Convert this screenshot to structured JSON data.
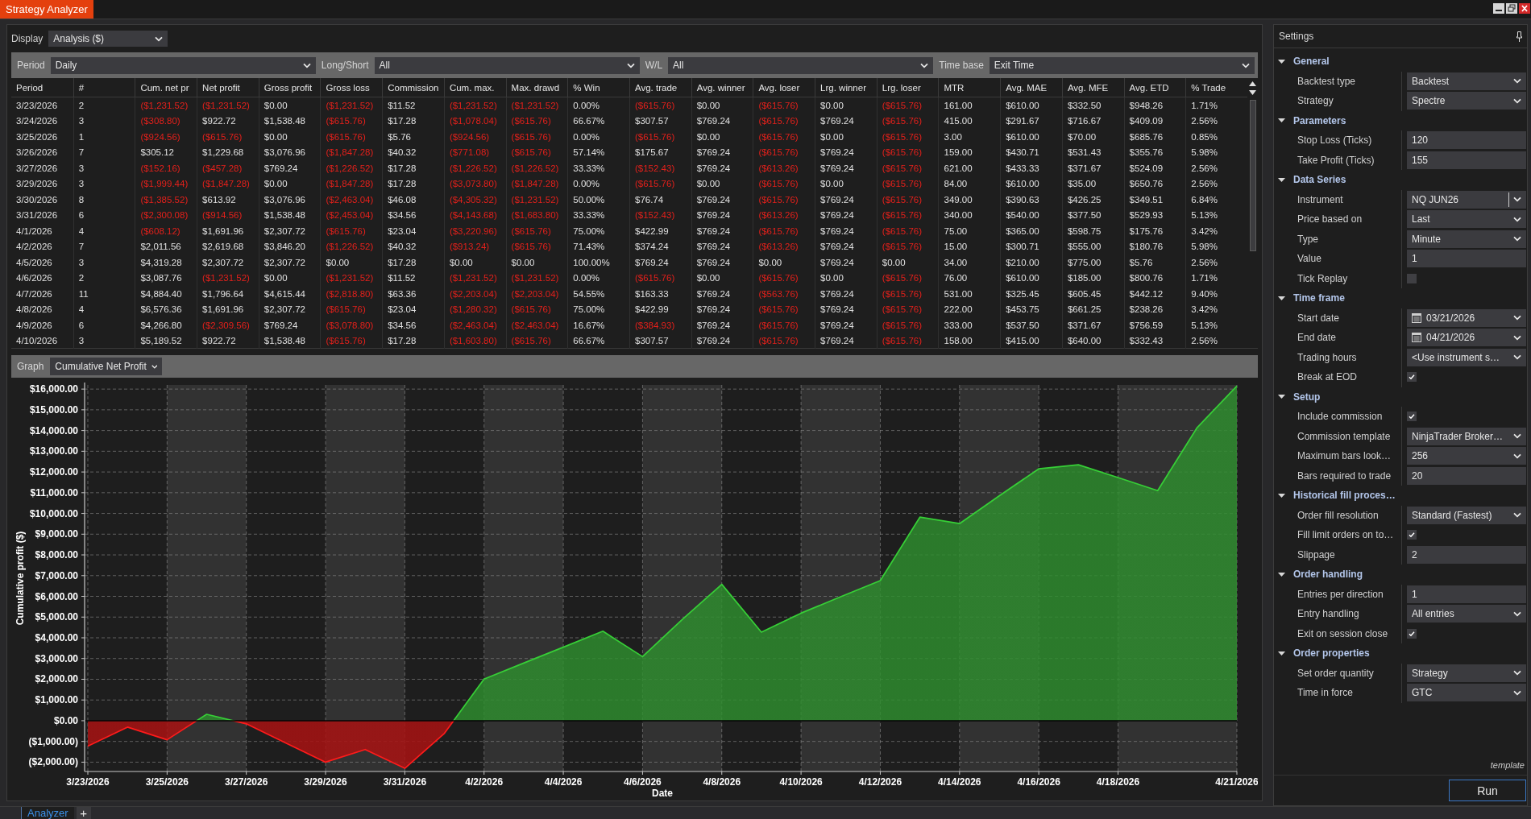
{
  "window": {
    "title": "Strategy Analyzer"
  },
  "display": {
    "label": "Display",
    "value": "Analysis ($)"
  },
  "filters": [
    {
      "label": "Period",
      "value": "Daily"
    },
    {
      "label": "Long/Short",
      "value": "All"
    },
    {
      "label": "W/L",
      "value": "All"
    },
    {
      "label": "Time base",
      "value": "Exit Time"
    }
  ],
  "table": {
    "columns": [
      "Period",
      "#",
      "Cum. net pr",
      "Net profit",
      "Gross profit",
      "Gross loss",
      "Commission",
      "Cum. max.",
      "Max. drawd",
      "% Win",
      "Avg. trade",
      "Avg. winner",
      "Avg. loser",
      "Lrg. winner",
      "Lrg. loser",
      "MTR",
      "Avg. MAE",
      "Avg. MFE",
      "Avg. ETD",
      "% Trade"
    ],
    "rows": [
      {
        "cells": [
          {
            "text": "3/23/2026",
            "negative": false
          },
          {
            "text": "2",
            "negative": false
          },
          {
            "text": "($1,231.52)",
            "negative": true
          },
          {
            "text": "($1,231.52)",
            "negative": true
          },
          {
            "text": "$0.00",
            "negative": false
          },
          {
            "text": "($1,231.52)",
            "negative": true
          },
          {
            "text": "$11.52",
            "negative": false
          },
          {
            "text": "($1,231.52)",
            "negative": true
          },
          {
            "text": "($1,231.52)",
            "negative": true
          },
          {
            "text": "0.00%",
            "negative": false
          },
          {
            "text": "($615.76)",
            "negative": true
          },
          {
            "text": "$0.00",
            "negative": false
          },
          {
            "text": "($615.76)",
            "negative": true
          },
          {
            "text": "$0.00",
            "negative": false
          },
          {
            "text": "($615.76)",
            "negative": true
          },
          {
            "text": "161.00",
            "negative": false
          },
          {
            "text": "$610.00",
            "negative": false
          },
          {
            "text": "$332.50",
            "negative": false
          },
          {
            "text": "$948.26",
            "negative": false
          },
          {
            "text": "1.71%",
            "negative": false
          }
        ]
      },
      {
        "cells": [
          {
            "text": "3/24/2026",
            "negative": false
          },
          {
            "text": "3",
            "negative": false
          },
          {
            "text": "($308.80)",
            "negative": true
          },
          {
            "text": "$922.72",
            "negative": false
          },
          {
            "text": "$1,538.48",
            "negative": false
          },
          {
            "text": "($615.76)",
            "negative": true
          },
          {
            "text": "$17.28",
            "negative": false
          },
          {
            "text": "($1,078.04)",
            "negative": true
          },
          {
            "text": "($615.76)",
            "negative": true
          },
          {
            "text": "66.67%",
            "negative": false
          },
          {
            "text": "$307.57",
            "negative": false
          },
          {
            "text": "$769.24",
            "negative": false
          },
          {
            "text": "($615.76)",
            "negative": true
          },
          {
            "text": "$769.24",
            "negative": false
          },
          {
            "text": "($615.76)",
            "negative": true
          },
          {
            "text": "415.00",
            "negative": false
          },
          {
            "text": "$291.67",
            "negative": false
          },
          {
            "text": "$716.67",
            "negative": false
          },
          {
            "text": "$409.09",
            "negative": false
          },
          {
            "text": "2.56%",
            "negative": false
          }
        ]
      },
      {
        "cells": [
          {
            "text": "3/25/2026",
            "negative": false
          },
          {
            "text": "1",
            "negative": false
          },
          {
            "text": "($924.56)",
            "negative": true
          },
          {
            "text": "($615.76)",
            "negative": true
          },
          {
            "text": "$0.00",
            "negative": false
          },
          {
            "text": "($615.76)",
            "negative": true
          },
          {
            "text": "$5.76",
            "negative": false
          },
          {
            "text": "($924.56)",
            "negative": true
          },
          {
            "text": "($615.76)",
            "negative": true
          },
          {
            "text": "0.00%",
            "negative": false
          },
          {
            "text": "($615.76)",
            "negative": true
          },
          {
            "text": "$0.00",
            "negative": false
          },
          {
            "text": "($615.76)",
            "negative": true
          },
          {
            "text": "$0.00",
            "negative": false
          },
          {
            "text": "($615.76)",
            "negative": true
          },
          {
            "text": "3.00",
            "negative": false
          },
          {
            "text": "$610.00",
            "negative": false
          },
          {
            "text": "$70.00",
            "negative": false
          },
          {
            "text": "$685.76",
            "negative": false
          },
          {
            "text": "0.85%",
            "negative": false
          }
        ]
      },
      {
        "cells": [
          {
            "text": "3/26/2026",
            "negative": false
          },
          {
            "text": "7",
            "negative": false
          },
          {
            "text": "$305.12",
            "negative": false
          },
          {
            "text": "$1,229.68",
            "negative": false
          },
          {
            "text": "$3,076.96",
            "negative": false
          },
          {
            "text": "($1,847.28)",
            "negative": true
          },
          {
            "text": "$40.32",
            "negative": false
          },
          {
            "text": "($771.08)",
            "negative": true
          },
          {
            "text": "($615.76)",
            "negative": true
          },
          {
            "text": "57.14%",
            "negative": false
          },
          {
            "text": "$175.67",
            "negative": false
          },
          {
            "text": "$769.24",
            "negative": false
          },
          {
            "text": "($615.76)",
            "negative": true
          },
          {
            "text": "$769.24",
            "negative": false
          },
          {
            "text": "($615.76)",
            "negative": true
          },
          {
            "text": "159.00",
            "negative": false
          },
          {
            "text": "$430.71",
            "negative": false
          },
          {
            "text": "$531.43",
            "negative": false
          },
          {
            "text": "$355.76",
            "negative": false
          },
          {
            "text": "5.98%",
            "negative": false
          }
        ]
      },
      {
        "cells": [
          {
            "text": "3/27/2026",
            "negative": false
          },
          {
            "text": "3",
            "negative": false
          },
          {
            "text": "($152.16)",
            "negative": true
          },
          {
            "text": "($457.28)",
            "negative": true
          },
          {
            "text": "$769.24",
            "negative": false
          },
          {
            "text": "($1,226.52)",
            "negative": true
          },
          {
            "text": "$17.28",
            "negative": false
          },
          {
            "text": "($1,226.52)",
            "negative": true
          },
          {
            "text": "($1,226.52)",
            "negative": true
          },
          {
            "text": "33.33%",
            "negative": false
          },
          {
            "text": "($152.43)",
            "negative": true
          },
          {
            "text": "$769.24",
            "negative": false
          },
          {
            "text": "($613.26)",
            "negative": true
          },
          {
            "text": "$769.24",
            "negative": false
          },
          {
            "text": "($615.76)",
            "negative": true
          },
          {
            "text": "621.00",
            "negative": false
          },
          {
            "text": "$433.33",
            "negative": false
          },
          {
            "text": "$371.67",
            "negative": false
          },
          {
            "text": "$524.09",
            "negative": false
          },
          {
            "text": "2.56%",
            "negative": false
          }
        ]
      },
      {
        "cells": [
          {
            "text": "3/29/2026",
            "negative": false
          },
          {
            "text": "3",
            "negative": false
          },
          {
            "text": "($1,999.44)",
            "negative": true
          },
          {
            "text": "($1,847.28)",
            "negative": true
          },
          {
            "text": "$0.00",
            "negative": false
          },
          {
            "text": "($1,847.28)",
            "negative": true
          },
          {
            "text": "$17.28",
            "negative": false
          },
          {
            "text": "($3,073.80)",
            "negative": true
          },
          {
            "text": "($1,847.28)",
            "negative": true
          },
          {
            "text": "0.00%",
            "negative": false
          },
          {
            "text": "($615.76)",
            "negative": true
          },
          {
            "text": "$0.00",
            "negative": false
          },
          {
            "text": "($615.76)",
            "negative": true
          },
          {
            "text": "$0.00",
            "negative": false
          },
          {
            "text": "($615.76)",
            "negative": true
          },
          {
            "text": "84.00",
            "negative": false
          },
          {
            "text": "$610.00",
            "negative": false
          },
          {
            "text": "$35.00",
            "negative": false
          },
          {
            "text": "$650.76",
            "negative": false
          },
          {
            "text": "2.56%",
            "negative": false
          }
        ]
      },
      {
        "cells": [
          {
            "text": "3/30/2026",
            "negative": false
          },
          {
            "text": "8",
            "negative": false
          },
          {
            "text": "($1,385.52)",
            "negative": true
          },
          {
            "text": "$613.92",
            "negative": false
          },
          {
            "text": "$3,076.96",
            "negative": false
          },
          {
            "text": "($2,463.04)",
            "negative": true
          },
          {
            "text": "$46.08",
            "negative": false
          },
          {
            "text": "($4,305.32)",
            "negative": true
          },
          {
            "text": "($1,231.52)",
            "negative": true
          },
          {
            "text": "50.00%",
            "negative": false
          },
          {
            "text": "$76.74",
            "negative": false
          },
          {
            "text": "$769.24",
            "negative": false
          },
          {
            "text": "($615.76)",
            "negative": true
          },
          {
            "text": "$769.24",
            "negative": false
          },
          {
            "text": "($615.76)",
            "negative": true
          },
          {
            "text": "349.00",
            "negative": false
          },
          {
            "text": "$390.63",
            "negative": false
          },
          {
            "text": "$426.25",
            "negative": false
          },
          {
            "text": "$349.51",
            "negative": false
          },
          {
            "text": "6.84%",
            "negative": false
          }
        ]
      },
      {
        "cells": [
          {
            "text": "3/31/2026",
            "negative": false
          },
          {
            "text": "6",
            "negative": false
          },
          {
            "text": "($2,300.08)",
            "negative": true
          },
          {
            "text": "($914.56)",
            "negative": true
          },
          {
            "text": "$1,538.48",
            "negative": false
          },
          {
            "text": "($2,453.04)",
            "negative": true
          },
          {
            "text": "$34.56",
            "negative": false
          },
          {
            "text": "($4,143.68)",
            "negative": true
          },
          {
            "text": "($1,683.80)",
            "negative": true
          },
          {
            "text": "33.33%",
            "negative": false
          },
          {
            "text": "($152.43)",
            "negative": true
          },
          {
            "text": "$769.24",
            "negative": false
          },
          {
            "text": "($613.26)",
            "negative": true
          },
          {
            "text": "$769.24",
            "negative": false
          },
          {
            "text": "($615.76)",
            "negative": true
          },
          {
            "text": "340.00",
            "negative": false
          },
          {
            "text": "$540.00",
            "negative": false
          },
          {
            "text": "$377.50",
            "negative": false
          },
          {
            "text": "$529.93",
            "negative": false
          },
          {
            "text": "5.13%",
            "negative": false
          }
        ]
      },
      {
        "cells": [
          {
            "text": "4/1/2026",
            "negative": false
          },
          {
            "text": "4",
            "negative": false
          },
          {
            "text": "($608.12)",
            "negative": true
          },
          {
            "text": "$1,691.96",
            "negative": false
          },
          {
            "text": "$2,307.72",
            "negative": false
          },
          {
            "text": "($615.76)",
            "negative": true
          },
          {
            "text": "$23.04",
            "negative": false
          },
          {
            "text": "($3,220.96)",
            "negative": true
          },
          {
            "text": "($615.76)",
            "negative": true
          },
          {
            "text": "75.00%",
            "negative": false
          },
          {
            "text": "$422.99",
            "negative": false
          },
          {
            "text": "$769.24",
            "negative": false
          },
          {
            "text": "($615.76)",
            "negative": true
          },
          {
            "text": "$769.24",
            "negative": false
          },
          {
            "text": "($615.76)",
            "negative": true
          },
          {
            "text": "75.00",
            "negative": false
          },
          {
            "text": "$365.00",
            "negative": false
          },
          {
            "text": "$598.75",
            "negative": false
          },
          {
            "text": "$175.76",
            "negative": false
          },
          {
            "text": "3.42%",
            "negative": false
          }
        ]
      },
      {
        "cells": [
          {
            "text": "4/2/2026",
            "negative": false
          },
          {
            "text": "7",
            "negative": false
          },
          {
            "text": "$2,011.56",
            "negative": false
          },
          {
            "text": "$2,619.68",
            "negative": false
          },
          {
            "text": "$3,846.20",
            "negative": false
          },
          {
            "text": "($1,226.52)",
            "negative": true
          },
          {
            "text": "$40.32",
            "negative": false
          },
          {
            "text": "($913.24)",
            "negative": true
          },
          {
            "text": "($615.76)",
            "negative": true
          },
          {
            "text": "71.43%",
            "negative": false
          },
          {
            "text": "$374.24",
            "negative": false
          },
          {
            "text": "$769.24",
            "negative": false
          },
          {
            "text": "($613.26)",
            "negative": true
          },
          {
            "text": "$769.24",
            "negative": false
          },
          {
            "text": "($615.76)",
            "negative": true
          },
          {
            "text": "15.00",
            "negative": false
          },
          {
            "text": "$300.71",
            "negative": false
          },
          {
            "text": "$555.00",
            "negative": false
          },
          {
            "text": "$180.76",
            "negative": false
          },
          {
            "text": "5.98%",
            "negative": false
          }
        ]
      },
      {
        "cells": [
          {
            "text": "4/5/2026",
            "negative": false
          },
          {
            "text": "3",
            "negative": false
          },
          {
            "text": "$4,319.28",
            "negative": false
          },
          {
            "text": "$2,307.72",
            "negative": false
          },
          {
            "text": "$2,307.72",
            "negative": false
          },
          {
            "text": "$0.00",
            "negative": false
          },
          {
            "text": "$17.28",
            "negative": false
          },
          {
            "text": "$0.00",
            "negative": false
          },
          {
            "text": "$0.00",
            "negative": false
          },
          {
            "text": "100.00%",
            "negative": false
          },
          {
            "text": "$769.24",
            "negative": false
          },
          {
            "text": "$769.24",
            "negative": false
          },
          {
            "text": "$0.00",
            "negative": false
          },
          {
            "text": "$769.24",
            "negative": false
          },
          {
            "text": "$0.00",
            "negative": false
          },
          {
            "text": "34.00",
            "negative": false
          },
          {
            "text": "$210.00",
            "negative": false
          },
          {
            "text": "$775.00",
            "negative": false
          },
          {
            "text": "$5.76",
            "negative": false
          },
          {
            "text": "2.56%",
            "negative": false
          }
        ]
      },
      {
        "cells": [
          {
            "text": "4/6/2026",
            "negative": false
          },
          {
            "text": "2",
            "negative": false
          },
          {
            "text": "$3,087.76",
            "negative": false
          },
          {
            "text": "($1,231.52)",
            "negative": true
          },
          {
            "text": "$0.00",
            "negative": false
          },
          {
            "text": "($1,231.52)",
            "negative": true
          },
          {
            "text": "$11.52",
            "negative": false
          },
          {
            "text": "($1,231.52)",
            "negative": true
          },
          {
            "text": "($1,231.52)",
            "negative": true
          },
          {
            "text": "0.00%",
            "negative": false
          },
          {
            "text": "($615.76)",
            "negative": true
          },
          {
            "text": "$0.00",
            "negative": false
          },
          {
            "text": "($615.76)",
            "negative": true
          },
          {
            "text": "$0.00",
            "negative": false
          },
          {
            "text": "($615.76)",
            "negative": true
          },
          {
            "text": "76.00",
            "negative": false
          },
          {
            "text": "$610.00",
            "negative": false
          },
          {
            "text": "$185.00",
            "negative": false
          },
          {
            "text": "$800.76",
            "negative": false
          },
          {
            "text": "1.71%",
            "negative": false
          }
        ]
      },
      {
        "cells": [
          {
            "text": "4/7/2026",
            "negative": false
          },
          {
            "text": "11",
            "negative": false
          },
          {
            "text": "$4,884.40",
            "negative": false
          },
          {
            "text": "$1,796.64",
            "negative": false
          },
          {
            "text": "$4,615.44",
            "negative": false
          },
          {
            "text": "($2,818.80)",
            "negative": true
          },
          {
            "text": "$63.36",
            "negative": false
          },
          {
            "text": "($2,203.04)",
            "negative": true
          },
          {
            "text": "($2,203.04)",
            "negative": true
          },
          {
            "text": "54.55%",
            "negative": false
          },
          {
            "text": "$163.33",
            "negative": false
          },
          {
            "text": "$769.24",
            "negative": false
          },
          {
            "text": "($563.76)",
            "negative": true
          },
          {
            "text": "$769.24",
            "negative": false
          },
          {
            "text": "($615.76)",
            "negative": true
          },
          {
            "text": "531.00",
            "negative": false
          },
          {
            "text": "$325.45",
            "negative": false
          },
          {
            "text": "$605.45",
            "negative": false
          },
          {
            "text": "$442.12",
            "negative": false
          },
          {
            "text": "9.40%",
            "negative": false
          }
        ]
      },
      {
        "cells": [
          {
            "text": "4/8/2026",
            "negative": false
          },
          {
            "text": "4",
            "negative": false
          },
          {
            "text": "$6,576.36",
            "negative": false
          },
          {
            "text": "$1,691.96",
            "negative": false
          },
          {
            "text": "$2,307.72",
            "negative": false
          },
          {
            "text": "($615.76)",
            "negative": true
          },
          {
            "text": "$23.04",
            "negative": false
          },
          {
            "text": "($1,280.32)",
            "negative": true
          },
          {
            "text": "($615.76)",
            "negative": true
          },
          {
            "text": "75.00%",
            "negative": false
          },
          {
            "text": "$422.99",
            "negative": false
          },
          {
            "text": "$769.24",
            "negative": false
          },
          {
            "text": "($615.76)",
            "negative": true
          },
          {
            "text": "$769.24",
            "negative": false
          },
          {
            "text": "($615.76)",
            "negative": true
          },
          {
            "text": "222.00",
            "negative": false
          },
          {
            "text": "$453.75",
            "negative": false
          },
          {
            "text": "$661.25",
            "negative": false
          },
          {
            "text": "$238.26",
            "negative": false
          },
          {
            "text": "3.42%",
            "negative": false
          }
        ]
      },
      {
        "cells": [
          {
            "text": "4/9/2026",
            "negative": false
          },
          {
            "text": "6",
            "negative": false
          },
          {
            "text": "$4,266.80",
            "negative": false
          },
          {
            "text": "($2,309.56)",
            "negative": true
          },
          {
            "text": "$769.24",
            "negative": false
          },
          {
            "text": "($3,078.80)",
            "negative": true
          },
          {
            "text": "$34.56",
            "negative": false
          },
          {
            "text": "($2,463.04)",
            "negative": true
          },
          {
            "text": "($2,463.04)",
            "negative": true
          },
          {
            "text": "16.67%",
            "negative": false
          },
          {
            "text": "($384.93)",
            "negative": true
          },
          {
            "text": "$769.24",
            "negative": false
          },
          {
            "text": "($615.76)",
            "negative": true
          },
          {
            "text": "$769.24",
            "negative": false
          },
          {
            "text": "($615.76)",
            "negative": true
          },
          {
            "text": "333.00",
            "negative": false
          },
          {
            "text": "$537.50",
            "negative": false
          },
          {
            "text": "$371.67",
            "negative": false
          },
          {
            "text": "$756.59",
            "negative": false
          },
          {
            "text": "5.13%",
            "negative": false
          }
        ]
      },
      {
        "cells": [
          {
            "text": "4/10/2026",
            "negative": false
          },
          {
            "text": "3",
            "negative": false
          },
          {
            "text": "$5,189.52",
            "negative": false
          },
          {
            "text": "$922.72",
            "negative": false
          },
          {
            "text": "$1,538.48",
            "negative": false
          },
          {
            "text": "($615.76)",
            "negative": true
          },
          {
            "text": "$17.28",
            "negative": false
          },
          {
            "text": "($1,603.80)",
            "negative": true
          },
          {
            "text": "($615.76)",
            "negative": true
          },
          {
            "text": "66.67%",
            "negative": false
          },
          {
            "text": "$307.57",
            "negative": false
          },
          {
            "text": "$769.24",
            "negative": false
          },
          {
            "text": "($615.76)",
            "negative": true
          },
          {
            "text": "$769.24",
            "negative": false
          },
          {
            "text": "($615.76)",
            "negative": true
          },
          {
            "text": "158.00",
            "negative": false
          },
          {
            "text": "$415.00",
            "negative": false
          },
          {
            "text": "$640.00",
            "negative": false
          },
          {
            "text": "$332.43",
            "negative": false
          },
          {
            "text": "2.56%",
            "negative": false
          }
        ]
      }
    ]
  },
  "graph": {
    "label": "Graph",
    "value": "Cumulative Net Profit",
    "chart_data": {
      "type": "area",
      "xlabel": "Date",
      "ylabel": "Cumulative profit ($)",
      "categories": [
        "3/23/2026",
        null,
        "3/25/2026",
        null,
        "3/27/2026",
        null,
        "3/29/2026",
        null,
        "3/31/2026",
        null,
        "4/2/2026",
        null,
        "4/4/2026",
        null,
        "4/6/2026",
        null,
        "4/8/2026",
        null,
        "4/10/2026",
        null,
        "4/12/2026",
        null,
        "4/14/2026",
        null,
        "4/16/2026",
        null,
        "4/18/2026",
        null,
        null,
        "4/21/2026"
      ],
      "values": [
        -1230,
        -310,
        -920,
        310,
        -150,
        -1080,
        -2000,
        -1390,
        -2300,
        -610,
        2010,
        2780,
        3550,
        4320,
        3090,
        4880,
        6580,
        4270,
        5190,
        5980,
        6760,
        9820,
        9510,
        10850,
        12150,
        12350,
        11730,
        11100,
        14150,
        16150
      ],
      "ylim": [
        -2450,
        16200
      ],
      "yticks": [
        {
          "value": -2000,
          "label": "($2,000.00)"
        },
        {
          "value": -1000,
          "label": "($1,000.00)"
        },
        {
          "value": 0,
          "label": "$0.00"
        },
        {
          "value": 1000,
          "label": "$1,000.00"
        },
        {
          "value": 2000,
          "label": "$2,000.00"
        },
        {
          "value": 3000,
          "label": "$3,000.00"
        },
        {
          "value": 4000,
          "label": "$4,000.00"
        },
        {
          "value": 5000,
          "label": "$5,000.00"
        },
        {
          "value": 6000,
          "label": "$6,000.00"
        },
        {
          "value": 7000,
          "label": "$7,000.00"
        },
        {
          "value": 8000,
          "label": "$8,000.00"
        },
        {
          "value": 9000,
          "label": "$9,000.00"
        },
        {
          "value": 10000,
          "label": "$10,000.00"
        },
        {
          "value": 11000,
          "label": "$11,000.00"
        },
        {
          "value": 12000,
          "label": "$12,000.00"
        },
        {
          "value": 13000,
          "label": "$13,000.00"
        },
        {
          "value": 14000,
          "label": "$14,000.00"
        },
        {
          "value": 15000,
          "label": "$15,000.00"
        },
        {
          "value": 16000,
          "label": "$16,000.00"
        }
      ],
      "grid": true
    }
  },
  "settings": {
    "title": "Settings",
    "groups": [
      {
        "label": "General",
        "expanded": true,
        "properties": [
          {
            "label": "Backtest type",
            "kind": "dropdown",
            "value": "Backtest"
          },
          {
            "label": "Strategy",
            "kind": "dropdown",
            "value": "Spectre"
          }
        ]
      },
      {
        "label": "Parameters",
        "expanded": true,
        "properties": [
          {
            "label": "Stop Loss (Ticks)",
            "kind": "text",
            "value": "120"
          },
          {
            "label": "Take Profit (Ticks)",
            "kind": "text",
            "value": "155"
          }
        ]
      },
      {
        "label": "Data Series",
        "expanded": true,
        "properties": [
          {
            "label": "Instrument",
            "kind": "combo",
            "value": "NQ JUN26"
          },
          {
            "label": "Price based on",
            "kind": "dropdown",
            "value": "Last"
          },
          {
            "label": "Type",
            "kind": "dropdown",
            "value": "Minute"
          },
          {
            "label": "Value",
            "kind": "text",
            "value": "1"
          },
          {
            "label": "Tick Replay",
            "kind": "checkbox",
            "checked": false
          }
        ]
      },
      {
        "label": "Time frame",
        "expanded": true,
        "properties": [
          {
            "label": "Start date",
            "kind": "date",
            "value": "03/21/2026"
          },
          {
            "label": "End date",
            "kind": "date",
            "value": "04/21/2026"
          },
          {
            "label": "Trading hours",
            "kind": "dropdown",
            "value": "<Use instrument s…"
          },
          {
            "label": "Break at EOD",
            "kind": "checkbox",
            "checked": true
          }
        ]
      },
      {
        "label": "Setup",
        "expanded": true,
        "properties": [
          {
            "label": "Include commission",
            "kind": "checkbox",
            "checked": true
          },
          {
            "label": "Commission template",
            "kind": "dropdown",
            "value": "NinjaTrader Broker…"
          },
          {
            "label": "Maximum bars look…",
            "kind": "dropdown",
            "value": "256"
          },
          {
            "label": "Bars required to trade",
            "kind": "text",
            "value": "20"
          }
        ]
      },
      {
        "label": "Historical fill proces…",
        "expanded": true,
        "properties": [
          {
            "label": "Order fill resolution",
            "kind": "dropdown",
            "value": "Standard (Fastest)"
          },
          {
            "label": "Fill limit orders on to…",
            "kind": "checkbox",
            "checked": true
          },
          {
            "label": "Slippage",
            "kind": "text",
            "value": "2"
          }
        ]
      },
      {
        "label": "Order handling",
        "expanded": true,
        "properties": [
          {
            "label": "Entries per direction",
            "kind": "text",
            "value": "1"
          },
          {
            "label": "Entry handling",
            "kind": "dropdown",
            "value": "All entries"
          },
          {
            "label": "Exit on session close",
            "kind": "checkbox",
            "checked": true
          }
        ]
      },
      {
        "label": "Order properties",
        "expanded": true,
        "properties": [
          {
            "label": "Set order quantity",
            "kind": "dropdown",
            "value": "Strategy"
          },
          {
            "label": "Time in force",
            "kind": "dropdown",
            "value": "GTC"
          }
        ]
      }
    ],
    "template_label": "template",
    "run_button": "Run"
  },
  "bottom_bar": {
    "tabs": [
      {
        "label": "Analyzer",
        "selected": true
      }
    ],
    "add_button": "+"
  }
}
